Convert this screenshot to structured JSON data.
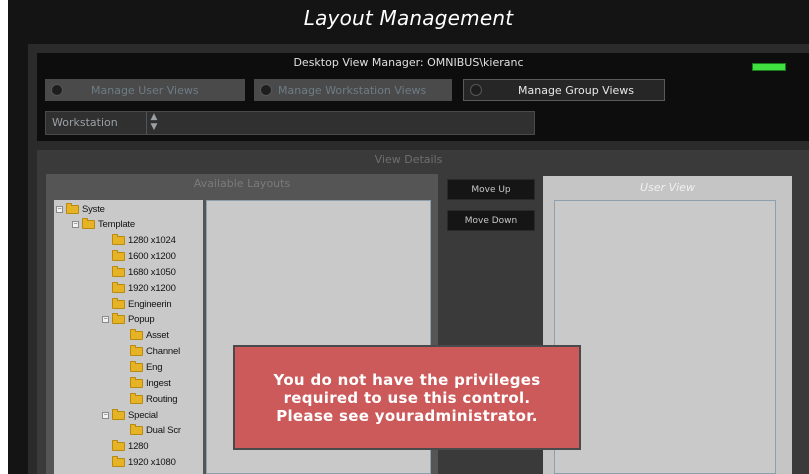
{
  "window": {
    "title": "Layout Management"
  },
  "header": {
    "desktop_view_manager": "Desktop View Manager:  OMNIBUS\\kieranc"
  },
  "view_buttons": {
    "user": "Manage User Views",
    "workstation": "Manage Workstation Views",
    "group": "Manage Group Views",
    "selected": "group"
  },
  "workstation": {
    "label": "Workstation",
    "value": ""
  },
  "view_details": {
    "label": "View Details",
    "available_label": "Available Layouts",
    "move_up": "Move Up",
    "move_down": "Move Down",
    "user_view_title": "User View"
  },
  "tree": [
    {
      "label": "Syste",
      "level": 0,
      "expander": "−"
    },
    {
      "label": "Template",
      "level": 1,
      "expander": "−"
    },
    {
      "label": "1280 x1024",
      "level": 2,
      "expander": ""
    },
    {
      "label": "1600 x1200",
      "level": 2,
      "expander": ""
    },
    {
      "label": "1680 x1050",
      "level": 2,
      "expander": ""
    },
    {
      "label": "1920 x1200",
      "level": 2,
      "expander": ""
    },
    {
      "label": "Engineerin",
      "level": 2,
      "expander": ""
    },
    {
      "label": "Popup",
      "level": 2,
      "expander": "−"
    },
    {
      "label": "Asset",
      "level": 3,
      "expander": ""
    },
    {
      "label": "Channel",
      "level": 3,
      "expander": ""
    },
    {
      "label": "Eng",
      "level": 3,
      "expander": ""
    },
    {
      "label": "Ingest",
      "level": 3,
      "expander": ""
    },
    {
      "label": "Routing",
      "level": 3,
      "expander": ""
    },
    {
      "label": "Special",
      "level": 2,
      "expander": "−"
    },
    {
      "label": "Dual Scr",
      "level": 3,
      "expander": ""
    },
    {
      "label": "1280",
      "level": 2,
      "expander": ""
    },
    {
      "label": "1920 x1080",
      "level": 2,
      "expander": ""
    }
  ],
  "message": {
    "lines": [
      "You do not have the privileges",
      "required to use this control.",
      "Please see youradministrator."
    ]
  },
  "colors": {
    "window_bg": "#141414",
    "status_led": "#3fe03f",
    "message_bg": "#cc5a5a",
    "folder": "#e6b325"
  }
}
